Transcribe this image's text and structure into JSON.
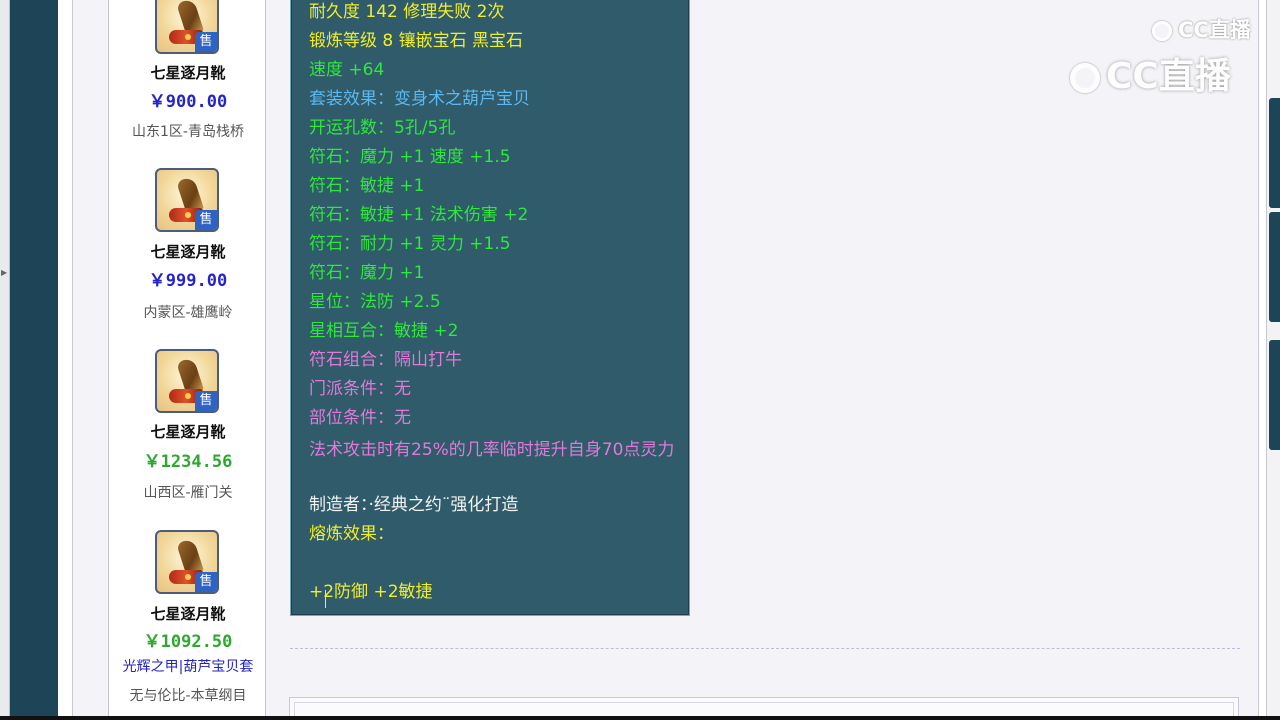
{
  "sidebar": {
    "items": [
      {
        "name": "七星逐月靴",
        "price": "￥900.00",
        "price_color": "#2424c8",
        "server": "山东1区-青岛栈桥",
        "badge": "售",
        "icon": "boots-icon"
      },
      {
        "name": "七星逐月靴",
        "price": "￥999.00",
        "price_color": "#2424c8",
        "server": "内蒙区-雄鹰岭",
        "badge": "售",
        "icon": "boots-icon"
      },
      {
        "name": "七星逐月靴",
        "price": "￥1234.56",
        "price_color": "#2ea82e",
        "server": "山西区-雁门关",
        "badge": "售",
        "icon": "boots-icon"
      },
      {
        "name": "七星逐月靴",
        "price": "￥1092.50",
        "price_color": "#2ea82e",
        "tags": [
          "光辉之甲",
          "葫芦宝贝套"
        ],
        "tag_separator": "|",
        "server": "无与伦比-本草纲目",
        "badge": "售",
        "icon": "boots-icon"
      }
    ]
  },
  "tooltip": {
    "lines": [
      {
        "text": "耐久度 142 修理失败 2次",
        "color": "yellow"
      },
      {
        "text": "锻炼等级 8 镶嵌宝石 黑宝石",
        "color": "yellow"
      },
      {
        "text": "速度 +64",
        "color": "green"
      },
      {
        "text": "套装效果：变身术之葫芦宝贝",
        "color": "blue"
      },
      {
        "text": "开运孔数：5孔/5孔",
        "color": "green"
      },
      {
        "text": "符石：魔力 +1 速度 +1.5",
        "color": "green"
      },
      {
        "text": "符石：敏捷 +1",
        "color": "green"
      },
      {
        "text": "符石：敏捷 +1 法术伤害 +2",
        "color": "green"
      },
      {
        "text": "符石：耐力 +1 灵力 +1.5",
        "color": "green"
      },
      {
        "text": "符石：魔力 +1",
        "color": "green"
      },
      {
        "text": "星位：法防 +2.5",
        "color": "green"
      },
      {
        "text": "星相互合：敏捷 +2",
        "color": "green"
      },
      {
        "text": "符石组合：隔山打牛",
        "color": "pink"
      },
      {
        "text": "门派条件：无",
        "color": "pink"
      },
      {
        "text": "部位条件：无",
        "color": "pink"
      },
      {
        "text": "法术攻击时有25%的几率临时提升自身70点灵力",
        "color": "pink"
      },
      {
        "text": "制造者：·经典之约¨强化打造",
        "color": "white"
      },
      {
        "text": "熔炼效果：",
        "color": "yellow"
      },
      {
        "text": "+2防御 +2敏捷",
        "color": "yellow"
      }
    ]
  },
  "watermark": {
    "small": "CC直播",
    "large": "CC直播"
  },
  "colors": {
    "frame_bg": "#1d4557",
    "tooltip_bg": "#2f5b6a",
    "yellow": "#f0ee2a",
    "green": "#2ee83a",
    "blue": "#5cb8f0",
    "pink": "#e07ad8"
  }
}
